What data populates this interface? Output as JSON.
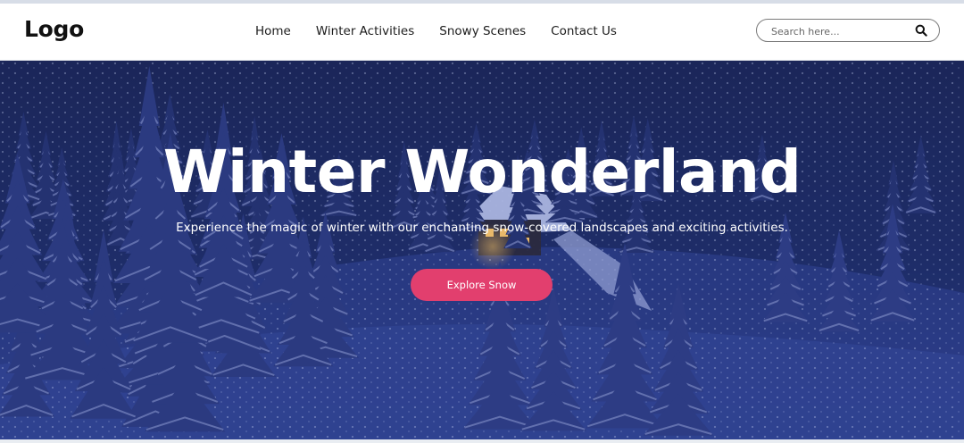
{
  "header": {
    "logo": "Logo",
    "nav": [
      {
        "label": "Home"
      },
      {
        "label": "Winter Activities"
      },
      {
        "label": "Snowy Scenes"
      },
      {
        "label": "Contact Us"
      }
    ],
    "search": {
      "placeholder": "Search here...",
      "icon": "search-icon"
    }
  },
  "hero": {
    "title": "Winter Wonderland",
    "subtitle": "Experience the magic of winter with our enchanting snow-covered landscapes and exciting activities.",
    "cta_label": "Explore Snow"
  },
  "colors": {
    "accent": "#e23f6e",
    "hero_overlay": "#1a2758",
    "header_bg": "#ffffff"
  }
}
